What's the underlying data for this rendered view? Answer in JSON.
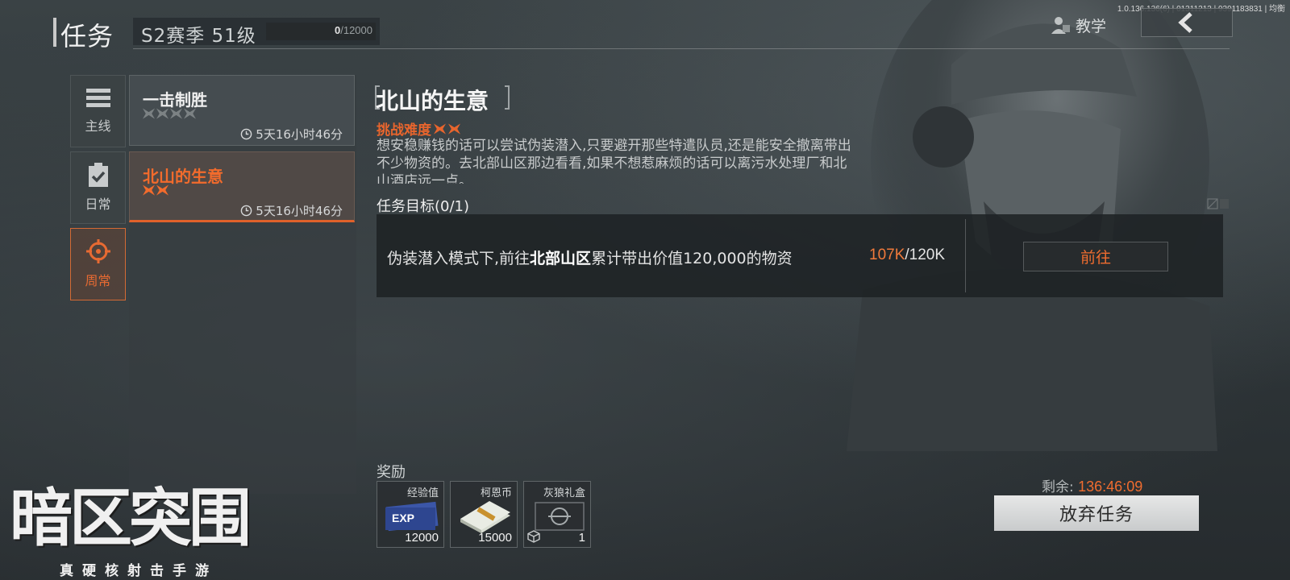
{
  "build_info": "1.0.136.136(6) | 01311213 | 9391183831 | 均衡",
  "header": {
    "title": "任务",
    "season_label": "S2赛季 51级",
    "exp_current": "0",
    "exp_max": "/12000",
    "tutorial_label": "教学",
    "tutorial_icon": "user-teach-icon",
    "back_icon": "chevron-left-icon"
  },
  "categories": [
    {
      "label": "主线",
      "icon": "list-icon",
      "active": false
    },
    {
      "label": "日常",
      "icon": "clipboard-check-icon",
      "active": false
    },
    {
      "label": "周常",
      "icon": "crosshair-icon",
      "active": true
    }
  ],
  "quests": [
    {
      "name": "一击制胜",
      "stars": 4,
      "stars_lit": 0,
      "timer": "5天16小时46分",
      "active": false
    },
    {
      "name": "北山的生意",
      "stars": 2,
      "stars_lit": 2,
      "timer": "5天16小时46分",
      "active": true
    }
  ],
  "detail": {
    "title": "北山的生意",
    "difficulty_label": "挑战难度",
    "difficulty_stars": 2,
    "description": "想安稳赚钱的话可以尝试伪装潜入,只要避开那些特遣队员,还是能安全撤离带出不少物资的。去北部山区那边看看,如果不想惹麻烦的话可以离污水处理厂和北山酒店远一点。",
    "objective_title": "任务目标(0/1)",
    "objective_prefix": "伪装潜入模式下,前往",
    "objective_place": "北部山区",
    "objective_suffix": "累计带出价值120,000的物资",
    "progress_current": "107K",
    "progress_target": "/120K",
    "goto_label": "前往"
  },
  "rewards": {
    "title": "奖励",
    "items": [
      {
        "name": "经验值",
        "count": "12000",
        "icon": "exp-card-icon"
      },
      {
        "name": "柯恩币",
        "count": "15000",
        "icon": "cash-stack-icon"
      },
      {
        "name": "灰狼礼盒",
        "count": "1",
        "icon": "gift-case-icon"
      }
    ]
  },
  "footer": {
    "remain_label": "剩余:",
    "remain_time": "136:46:09",
    "abandon_label": "放弃任务"
  },
  "logo": {
    "main": "暗区突围",
    "sub": "真硬核射击手游"
  },
  "colors": {
    "accent": "#ef6c2f",
    "panel_dark": "#1e2224",
    "text_light": "#e8e8e8"
  }
}
